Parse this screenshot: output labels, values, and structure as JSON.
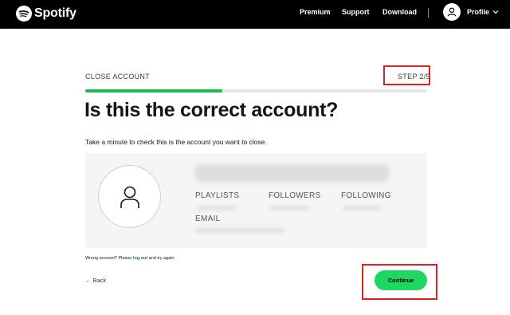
{
  "nav": {
    "brand": "Spotify",
    "links": [
      "Premium",
      "Support",
      "Download"
    ],
    "profile_label": "Profile"
  },
  "page": {
    "section_label": "CLOSE ACCOUNT",
    "step_label": "STEP 2/5",
    "progress_fraction": 0.4,
    "title": "Is this the correct account?",
    "subtitle": "Take a minute to check this is the account you want to close."
  },
  "account_card": {
    "stats": [
      "PLAYLISTS",
      "FOLLOWERS",
      "FOLLOWING"
    ],
    "email_label": "EMAIL"
  },
  "footer": {
    "wrong_prefix": "Wrong account? Please ",
    "wrong_link": "log out",
    "wrong_suffix": " and try again.",
    "back_label": "← Back",
    "continue_label": "Continue"
  },
  "colors": {
    "brand_green": "#1ed760",
    "progress_green": "#1db954",
    "highlight_red": "#e2211c",
    "topbar": "#000000"
  },
  "icons": [
    "spotify-logo-icon",
    "user-icon",
    "chevron-down-icon"
  ]
}
